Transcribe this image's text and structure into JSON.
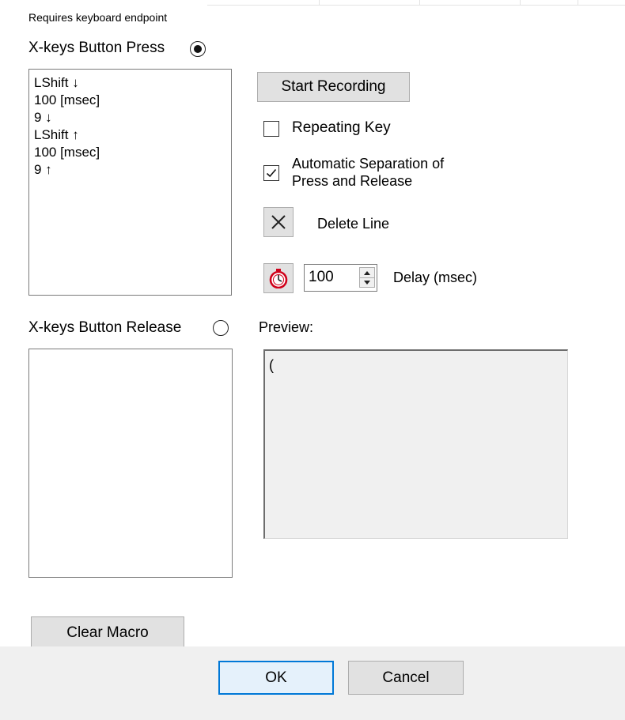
{
  "note": "Requires keyboard endpoint",
  "press_section": {
    "label": "X-keys Button Press",
    "selected": true,
    "items": [
      "LShift ↓",
      "100 [msec]",
      "9 ↓",
      "LShift ↑",
      "100 [msec]",
      "9 ↑"
    ]
  },
  "release_section": {
    "label": "X-keys Button Release",
    "selected": false,
    "items": []
  },
  "controls": {
    "start_recording_label": "Start Recording",
    "repeating_key": {
      "label": "Repeating Key",
      "checked": false
    },
    "auto_separation": {
      "label_line1": "Automatic Separation of",
      "label_line2": "Press and Release",
      "checked": true
    },
    "delete_line_label": "Delete Line",
    "delay": {
      "value": "100",
      "label": "Delay (msec)"
    }
  },
  "preview": {
    "label": "Preview:",
    "text": "("
  },
  "clear_macro_label": "Clear Macro",
  "footer": {
    "ok_label": "OK",
    "cancel_label": "Cancel"
  },
  "icons": {
    "press_radio": "radio-checked-icon",
    "release_radio": "radio-unchecked-icon",
    "delete": "close-x-icon",
    "delay": "stopwatch-icon",
    "spin_up": "triangle-up-icon",
    "spin_down": "triangle-down-icon"
  },
  "colors": {
    "button_face": "#e1e1e1",
    "default_button_border": "#0078d7",
    "stopwatch_red": "#d0021b",
    "footer_bg": "#f0f0f0"
  }
}
